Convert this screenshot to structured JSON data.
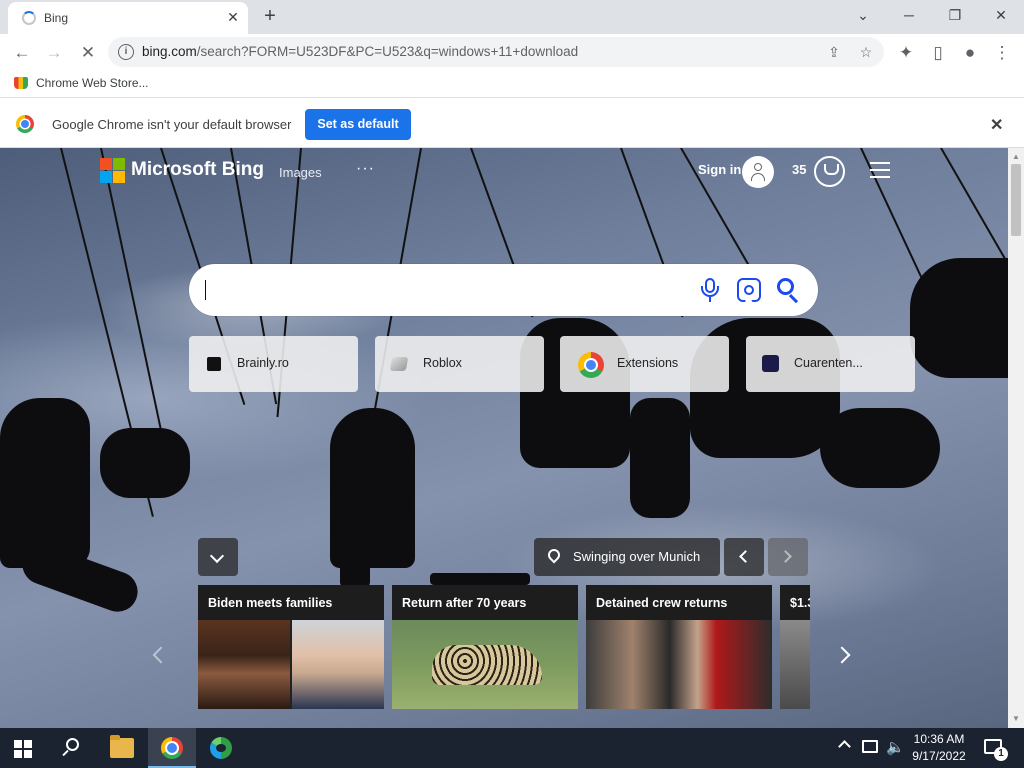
{
  "browser": {
    "tab": {
      "title": "Bing",
      "close_icon": "close-icon",
      "loading": true
    },
    "new_tab_icon": "plus-icon",
    "window_controls": [
      "chevron-down-icon",
      "minimize-icon",
      "restore-icon",
      "close-icon"
    ],
    "omnibox": {
      "url_host": "bing.com",
      "url_rest": "/search?FORM=U523DF&PC=U523&q=windows+11+download"
    },
    "bookmarks": [
      {
        "label": "Chrome Web Store..."
      }
    ]
  },
  "infobar": {
    "message": "Google Chrome isn't your default browser",
    "button_label": "Set as default"
  },
  "bing": {
    "brand": "Microsoft Bing",
    "nav_images": "Images",
    "nav_more": "···",
    "sign_in": "Sign in",
    "points": "35",
    "search_value": "",
    "quick_links": [
      {
        "label": "Brainly.ro"
      },
      {
        "label": "Roblox"
      },
      {
        "label": "Extensions"
      },
      {
        "label": "Cuarenten..."
      }
    ],
    "image_location": "Swinging over Munich",
    "news": [
      {
        "title": "Biden meets families"
      },
      {
        "title": "Return after 70 years"
      },
      {
        "title": "Detained crew returns"
      },
      {
        "title": "$1.3"
      }
    ],
    "colors": {
      "search_icon_blue": "#1b4aef",
      "accent_blue": "#1a73e8"
    }
  },
  "taskbar": {
    "time": "10:36 AM",
    "date": "9/17/2022",
    "notification_count": "1"
  }
}
